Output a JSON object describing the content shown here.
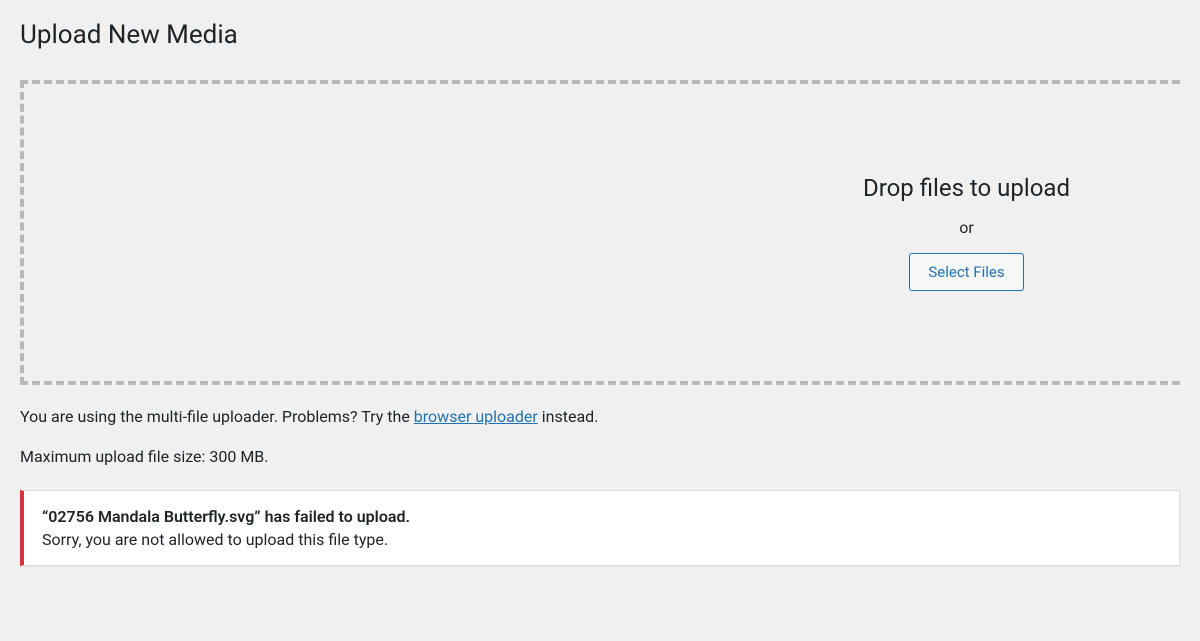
{
  "page": {
    "title": "Upload New Media"
  },
  "dropzone": {
    "heading": "Drop files to upload",
    "or_label": "or",
    "select_files_label": "Select Files"
  },
  "uploader_info": {
    "prefix": "You are using the multi-file uploader. Problems? Try the ",
    "link_text": "browser uploader",
    "suffix": " instead."
  },
  "max_size": {
    "text": "Maximum upload file size: 300 MB."
  },
  "error": {
    "title": "“02756 Mandala Butterfly.svg” has failed to upload.",
    "message": "Sorry, you are not allowed to upload this file type."
  }
}
